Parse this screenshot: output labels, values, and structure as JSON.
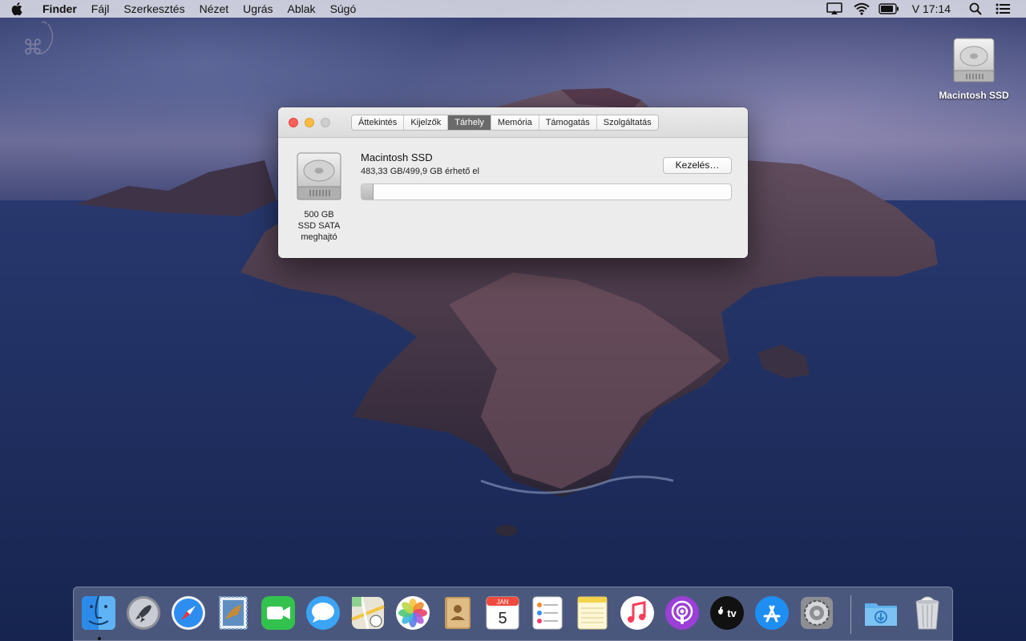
{
  "menubar": {
    "app": "Finder",
    "items": [
      "Fájl",
      "Szerkesztés",
      "Nézet",
      "Ugrás",
      "Ablak",
      "Súgó"
    ],
    "clock": "V 17:14"
  },
  "desktop": {
    "drive_label": "Macintosh SSD"
  },
  "window": {
    "tabs": [
      "Áttekintés",
      "Kijelzők",
      "Tárhely",
      "Memória",
      "Támogatás",
      "Szolgáltatás"
    ],
    "active_tab": "Tárhely",
    "volume_name": "Macintosh SSD",
    "available": "483,33 GB/499,9 GB érhető el",
    "drive_caption": [
      "500 GB",
      "SSD SATA",
      "meghajtó"
    ],
    "manage_label": "Kezelés…",
    "used_fraction": 0.033
  },
  "dock": {
    "items": [
      "finder",
      "launchpad",
      "safari",
      "mail",
      "facetime",
      "messages",
      "maps",
      "photos",
      "contacts",
      "calendar",
      "reminders",
      "notes",
      "music",
      "podcasts",
      "tv",
      "app-store",
      "system-preferences",
      "downloads",
      "trash"
    ],
    "calendar_month": "JAN",
    "calendar_day": "5",
    "tv_label": "tv"
  }
}
